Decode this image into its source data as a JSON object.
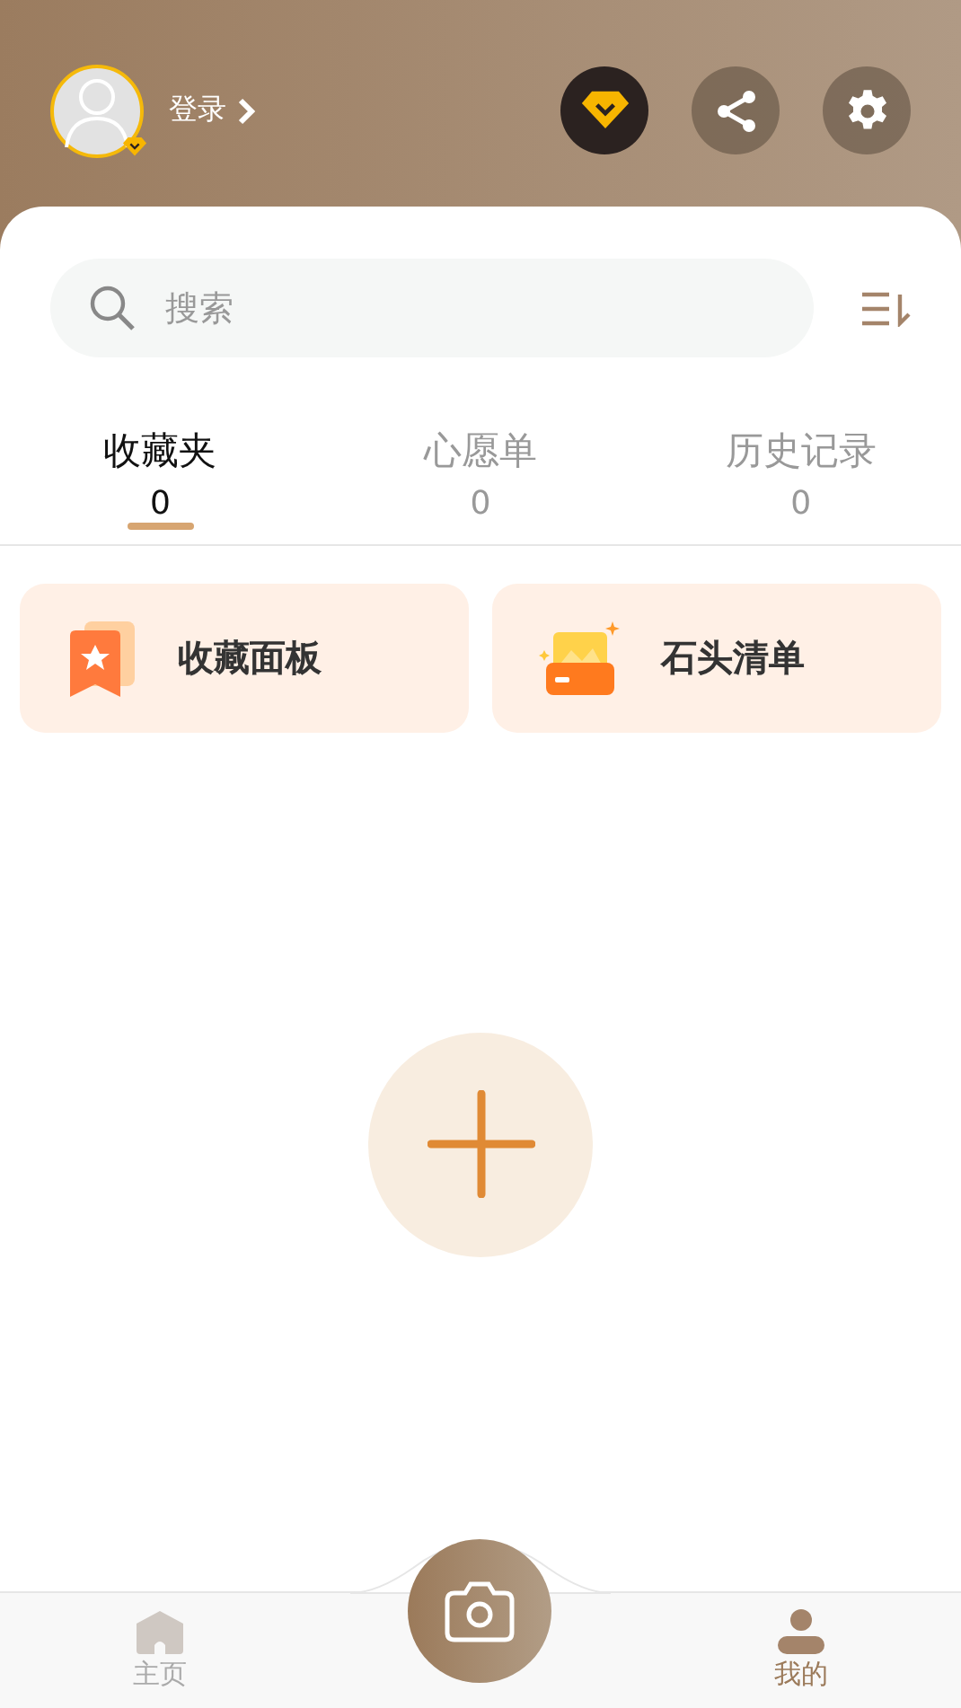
{
  "header": {
    "login": "登录"
  },
  "search": {
    "placeholder": "搜索"
  },
  "tabs": [
    {
      "label": "收藏夹",
      "count": "0",
      "selected": true
    },
    {
      "label": "心愿单",
      "count": "0",
      "selected": false
    },
    {
      "label": "历史记录",
      "count": "0",
      "selected": false
    }
  ],
  "cards": [
    {
      "kind": "board",
      "label": "收藏面板"
    },
    {
      "kind": "list",
      "label": "石头清单"
    }
  ],
  "nav": [
    {
      "kind": "home",
      "label": "主页",
      "selected": false
    },
    {
      "kind": "camera"
    },
    {
      "kind": "me",
      "label": "我的",
      "selected": true
    }
  ]
}
